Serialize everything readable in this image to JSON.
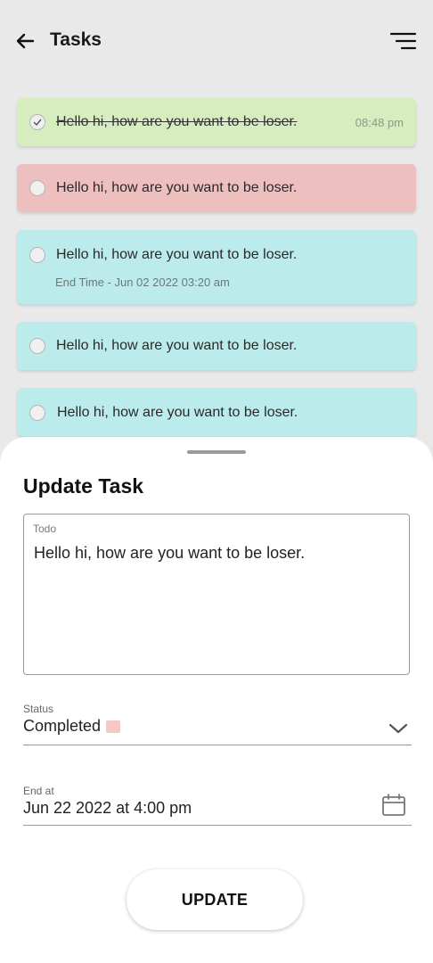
{
  "header": {
    "title": "Tasks",
    "back_icon": "arrow-left-icon",
    "menu_icon": "filter-menu-icon"
  },
  "tasks": [
    {
      "text": "Hello hi, how are you want to be loser.",
      "time": "08:48 pm",
      "completed": true,
      "color": "#d5edbf"
    },
    {
      "text": "Hello hi, how are you want to be loser.",
      "completed": false,
      "color": "#edbfbf"
    },
    {
      "text": "Hello hi, how are you want to be loser.",
      "sub": "End Time - Jun 02 2022 03:20 am",
      "completed": false,
      "color": "#bcebeb"
    },
    {
      "text": "Hello hi, how are you want to be loser.",
      "completed": false,
      "color": "#bcebeb"
    },
    {
      "text": "Hello hi, how are you want to be loser.",
      "completed": false,
      "color": "#bcebeb"
    }
  ],
  "sheet": {
    "title": "Update Task",
    "todo_label": "Todo",
    "todo_value": "Hello hi, how are you want to be loser.",
    "status_label": "Status",
    "status_value": "Completed",
    "status_color": "#f6c7c7",
    "end_label": "End at",
    "end_value": "Jun 22 2022 at 4:00 pm",
    "button_label": "UPDATE"
  }
}
